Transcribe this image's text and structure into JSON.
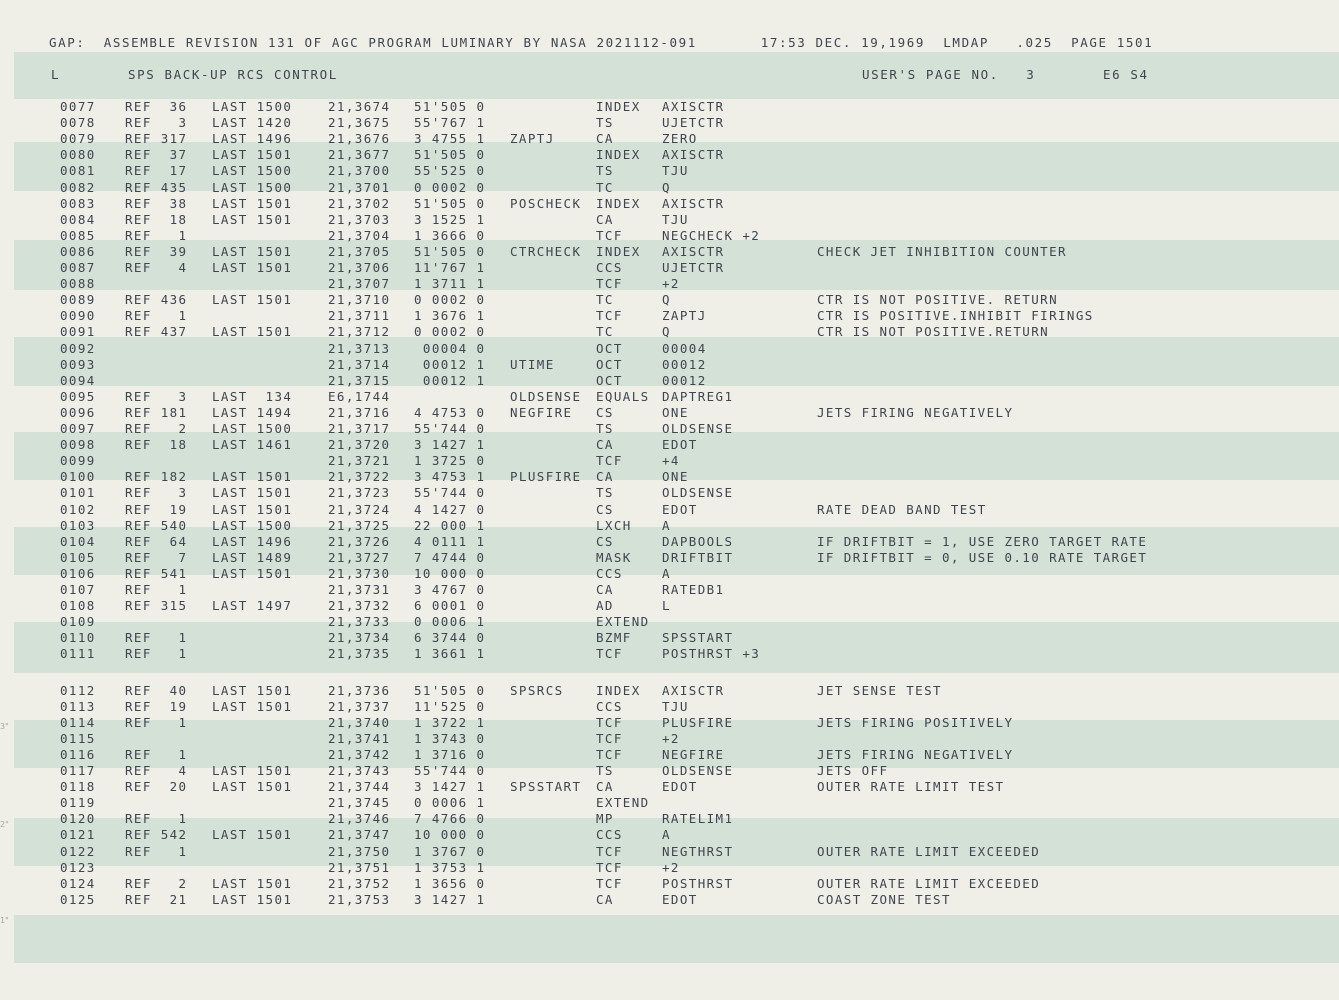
{
  "header": {
    "line": "GAP:  ASSEMBLE REVISION 131 OF AGC PROGRAM LUMINARY BY NASA 2021112-091       17:53 DEC. 19,1969  LMDAP   .025  PAGE 1501"
  },
  "subheader": {
    "type": "L",
    "title": "SPS BACK-UP RCS CONTROL",
    "users_page": "USER'S PAGE NO.   3",
    "bank": "E6 S4"
  },
  "margin_marks": [
    "3\"",
    "2\"",
    "1\""
  ],
  "rows": [
    {
      "line": "0077",
      "ref": "REF  36",
      "last": "LAST 1500",
      "addr": "21,3674",
      "word": "51'505 0",
      "label": "",
      "op": "INDEX",
      "arg": "AXISCTR",
      "comment": ""
    },
    {
      "line": "0078",
      "ref": "REF   3",
      "last": "LAST 1420",
      "addr": "21,3675",
      "word": "55'767 1",
      "label": "",
      "op": "TS",
      "arg": "UJETCTR",
      "comment": ""
    },
    {
      "line": "0079",
      "ref": "REF 317",
      "last": "LAST 1496",
      "addr": "21,3676",
      "word": "3 4755 1",
      "label": "ZAPTJ",
      "op": "CA",
      "arg": "ZERO",
      "comment": ""
    },
    {
      "line": "0080",
      "ref": "REF  37",
      "last": "LAST 1501",
      "addr": "21,3677",
      "word": "51'505 0",
      "label": "",
      "op": "INDEX",
      "arg": "AXISCTR",
      "comment": ""
    },
    {
      "line": "0081",
      "ref": "REF  17",
      "last": "LAST 1500",
      "addr": "21,3700",
      "word": "55'525 0",
      "label": "",
      "op": "TS",
      "arg": "TJU",
      "comment": ""
    },
    {
      "line": "0082",
      "ref": "REF 435",
      "last": "LAST 1500",
      "addr": "21,3701",
      "word": "0 0002 0",
      "label": "",
      "op": "TC",
      "arg": "Q",
      "comment": ""
    },
    {
      "line": "0083",
      "ref": "REF  38",
      "last": "LAST 1501",
      "addr": "21,3702",
      "word": "51'505 0",
      "label": "POSCHECK",
      "op": "INDEX",
      "arg": "AXISCTR",
      "comment": ""
    },
    {
      "line": "0084",
      "ref": "REF  18",
      "last": "LAST 1501",
      "addr": "21,3703",
      "word": "3 1525 1",
      "label": "",
      "op": "CA",
      "arg": "TJU",
      "comment": ""
    },
    {
      "line": "0085",
      "ref": "REF   1",
      "last": "",
      "addr": "21,3704",
      "word": "1 3666 0",
      "label": "",
      "op": "TCF",
      "arg": "NEGCHECK +2",
      "comment": ""
    },
    {
      "line": "0086",
      "ref": "REF  39",
      "last": "LAST 1501",
      "addr": "21,3705",
      "word": "51'505 0",
      "label": "CTRCHECK",
      "op": "INDEX",
      "arg": "AXISCTR",
      "comment": "CHECK JET INHIBITION COUNTER"
    },
    {
      "line": "0087",
      "ref": "REF   4",
      "last": "LAST 1501",
      "addr": "21,3706",
      "word": "11'767 1",
      "label": "",
      "op": "CCS",
      "arg": "UJETCTR",
      "comment": ""
    },
    {
      "line": "0088",
      "ref": "",
      "last": "",
      "addr": "21,3707",
      "word": "1 3711 1",
      "label": "",
      "op": "TCF",
      "arg": "+2",
      "comment": ""
    },
    {
      "line": "0089",
      "ref": "REF 436",
      "last": "LAST 1501",
      "addr": "21,3710",
      "word": "0 0002 0",
      "label": "",
      "op": "TC",
      "arg": "Q",
      "comment": "CTR IS NOT POSITIVE. RETURN"
    },
    {
      "line": "0090",
      "ref": "REF   1",
      "last": "",
      "addr": "21,3711",
      "word": "1 3676 1",
      "label": "",
      "op": "TCF",
      "arg": "ZAPTJ",
      "comment": "CTR IS POSITIVE.INHIBIT FIRINGS"
    },
    {
      "line": "0091",
      "ref": "REF 437",
      "last": "LAST 1501",
      "addr": "21,3712",
      "word": "0 0002 0",
      "label": "",
      "op": "TC",
      "arg": "Q",
      "comment": "CTR IS NOT POSITIVE.RETURN"
    },
    {
      "line": "0092",
      "ref": "",
      "last": "",
      "addr": "21,3713",
      "word": " 00004 0",
      "label": "",
      "op": "OCT",
      "arg": "00004",
      "comment": ""
    },
    {
      "line": "0093",
      "ref": "",
      "last": "",
      "addr": "21,3714",
      "word": " 00012 1",
      "label": "UTIME",
      "op": "OCT",
      "arg": "00012",
      "comment": ""
    },
    {
      "line": "0094",
      "ref": "",
      "last": "",
      "addr": "21,3715",
      "word": " 00012 1",
      "label": "",
      "op": "OCT",
      "arg": "00012",
      "comment": ""
    },
    {
      "line": "0095",
      "ref": "REF   3",
      "last": "LAST  134",
      "addr": "E6,1744",
      "word": "",
      "label": "OLDSENSE",
      "op": "EQUALS",
      "arg": "DAPTREG1",
      "comment": ""
    },
    {
      "line": "0096",
      "ref": "REF 181",
      "last": "LAST 1494",
      "addr": "21,3716",
      "word": "4 4753 0",
      "label": "NEGFIRE",
      "op": "CS",
      "arg": "ONE",
      "comment": "JETS FIRING NEGATIVELY"
    },
    {
      "line": "0097",
      "ref": "REF   2",
      "last": "LAST 1500",
      "addr": "21,3717",
      "word": "55'744 0",
      "label": "",
      "op": "TS",
      "arg": "OLDSENSE",
      "comment": ""
    },
    {
      "line": "0098",
      "ref": "REF  18",
      "last": "LAST 1461",
      "addr": "21,3720",
      "word": "3 1427 1",
      "label": "",
      "op": "CA",
      "arg": "EDOT",
      "comment": ""
    },
    {
      "line": "0099",
      "ref": "",
      "last": "",
      "addr": "21,3721",
      "word": "1 3725 0",
      "label": "",
      "op": "TCF",
      "arg": "+4",
      "comment": ""
    },
    {
      "line": "0100",
      "ref": "REF 182",
      "last": "LAST 1501",
      "addr": "21,3722",
      "word": "3 4753 1",
      "label": "PLUSFIRE",
      "op": "CA",
      "arg": "ONE",
      "comment": ""
    },
    {
      "line": "0101",
      "ref": "REF   3",
      "last": "LAST 1501",
      "addr": "21,3723",
      "word": "55'744 0",
      "label": "",
      "op": "TS",
      "arg": "OLDSENSE",
      "comment": ""
    },
    {
      "line": "0102",
      "ref": "REF  19",
      "last": "LAST 1501",
      "addr": "21,3724",
      "word": "4 1427 0",
      "label": "",
      "op": "CS",
      "arg": "EDOT",
      "comment": "RATE DEAD BAND TEST"
    },
    {
      "line": "0103",
      "ref": "REF 540",
      "last": "LAST 1500",
      "addr": "21,3725",
      "word": "22 000 1",
      "label": "",
      "op": "LXCH",
      "arg": "A",
      "comment": ""
    },
    {
      "line": "0104",
      "ref": "REF  64",
      "last": "LAST 1496",
      "addr": "21,3726",
      "word": "4 0111 1",
      "label": "",
      "op": "CS",
      "arg": "DAPBOOLS",
      "comment": "IF DRIFTBIT = 1, USE ZERO TARGET RATE"
    },
    {
      "line": "0105",
      "ref": "REF   7",
      "last": "LAST 1489",
      "addr": "21,3727",
      "word": "7 4744 0",
      "label": "",
      "op": "MASK",
      "arg": "DRIFTBIT",
      "comment": "IF DRIFTBIT = 0, USE 0.10 RATE TARGET"
    },
    {
      "line": "0106",
      "ref": "REF 541",
      "last": "LAST 1501",
      "addr": "21,3730",
      "word": "10 000 0",
      "label": "",
      "op": "CCS",
      "arg": "A",
      "comment": ""
    },
    {
      "line": "0107",
      "ref": "REF   1",
      "last": "",
      "addr": "21,3731",
      "word": "3 4767 0",
      "label": "",
      "op": "CA",
      "arg": "RATEDB1",
      "comment": ""
    },
    {
      "line": "0108",
      "ref": "REF 315",
      "last": "LAST 1497",
      "addr": "21,3732",
      "word": "6 0001 0",
      "label": "",
      "op": "AD",
      "arg": "L",
      "comment": ""
    },
    {
      "line": "0109",
      "ref": "",
      "last": "",
      "addr": "21,3733",
      "word": "0 0006 1",
      "label": "",
      "op": "EXTEND",
      "arg": "",
      "comment": ""
    },
    {
      "line": "0110",
      "ref": "REF   1",
      "last": "",
      "addr": "21,3734",
      "word": "6 3744 0",
      "label": "",
      "op": "BZMF",
      "arg": "SPSSTART",
      "comment": ""
    },
    {
      "line": "0111",
      "ref": "REF   1",
      "last": "",
      "addr": "21,3735",
      "word": "1 3661 1",
      "label": "",
      "op": "TCF",
      "arg": "POSTHRST +3",
      "comment": ""
    },
    {
      "line": "0112",
      "ref": "REF  40",
      "last": "LAST 1501",
      "addr": "21,3736",
      "word": "51'505 0",
      "label": "SPSRCS",
      "op": "INDEX",
      "arg": "AXISCTR",
      "comment": "JET SENSE TEST"
    },
    {
      "line": "0113",
      "ref": "REF  19",
      "last": "LAST 1501",
      "addr": "21,3737",
      "word": "11'525 0",
      "label": "",
      "op": "CCS",
      "arg": "TJU",
      "comment": ""
    },
    {
      "line": "0114",
      "ref": "REF   1",
      "last": "",
      "addr": "21,3740",
      "word": "1 3722 1",
      "label": "",
      "op": "TCF",
      "arg": "PLUSFIRE",
      "comment": "JETS FIRING POSITIVELY"
    },
    {
      "line": "0115",
      "ref": "",
      "last": "",
      "addr": "21,3741",
      "word": "1 3743 0",
      "label": "",
      "op": "TCF",
      "arg": "+2",
      "comment": ""
    },
    {
      "line": "0116",
      "ref": "REF   1",
      "last": "",
      "addr": "21,3742",
      "word": "1 3716 0",
      "label": "",
      "op": "TCF",
      "arg": "NEGFIRE",
      "comment": "JETS FIRING NEGATIVELY"
    },
    {
      "line": "0117",
      "ref": "REF   4",
      "last": "LAST 1501",
      "addr": "21,3743",
      "word": "55'744 0",
      "label": "",
      "op": "TS",
      "arg": "OLDSENSE",
      "comment": "JETS OFF"
    },
    {
      "line": "0118",
      "ref": "REF  20",
      "last": "LAST 1501",
      "addr": "21,3744",
      "word": "3 1427 1",
      "label": "SPSSTART",
      "op": "CA",
      "arg": "EDOT",
      "comment": "OUTER RATE LIMIT TEST"
    },
    {
      "line": "0119",
      "ref": "",
      "last": "",
      "addr": "21,3745",
      "word": "0 0006 1",
      "label": "",
      "op": "EXTEND",
      "arg": "",
      "comment": ""
    },
    {
      "line": "0120",
      "ref": "REF   1",
      "last": "",
      "addr": "21,3746",
      "word": "7 4766 0",
      "label": "",
      "op": "MP",
      "arg": "RATELIM1",
      "comment": ""
    },
    {
      "line": "0121",
      "ref": "REF 542",
      "last": "LAST 1501",
      "addr": "21,3747",
      "word": "10 000 0",
      "label": "",
      "op": "CCS",
      "arg": "A",
      "comment": ""
    },
    {
      "line": "0122",
      "ref": "REF   1",
      "last": "",
      "addr": "21,3750",
      "word": "1 3767 0",
      "label": "",
      "op": "TCF",
      "arg": "NEGTHRST",
      "comment": "OUTER RATE LIMIT EXCEEDED"
    },
    {
      "line": "0123",
      "ref": "",
      "last": "",
      "addr": "21,3751",
      "word": "1 3753 1",
      "label": "",
      "op": "TCF",
      "arg": "+2",
      "comment": ""
    },
    {
      "line": "0124",
      "ref": "REF   2",
      "last": "LAST 1501",
      "addr": "21,3752",
      "word": "1 3656 0",
      "label": "",
      "op": "TCF",
      "arg": "POSTHRST",
      "comment": "OUTER RATE LIMIT EXCEEDED"
    },
    {
      "line": "0125",
      "ref": "REF  21",
      "last": "LAST 1501",
      "addr": "21,3753",
      "word": "3 1427 1",
      "label": "",
      "op": "CA",
      "arg": "EDOT",
      "comment": "COAST ZONE TEST"
    }
  ]
}
